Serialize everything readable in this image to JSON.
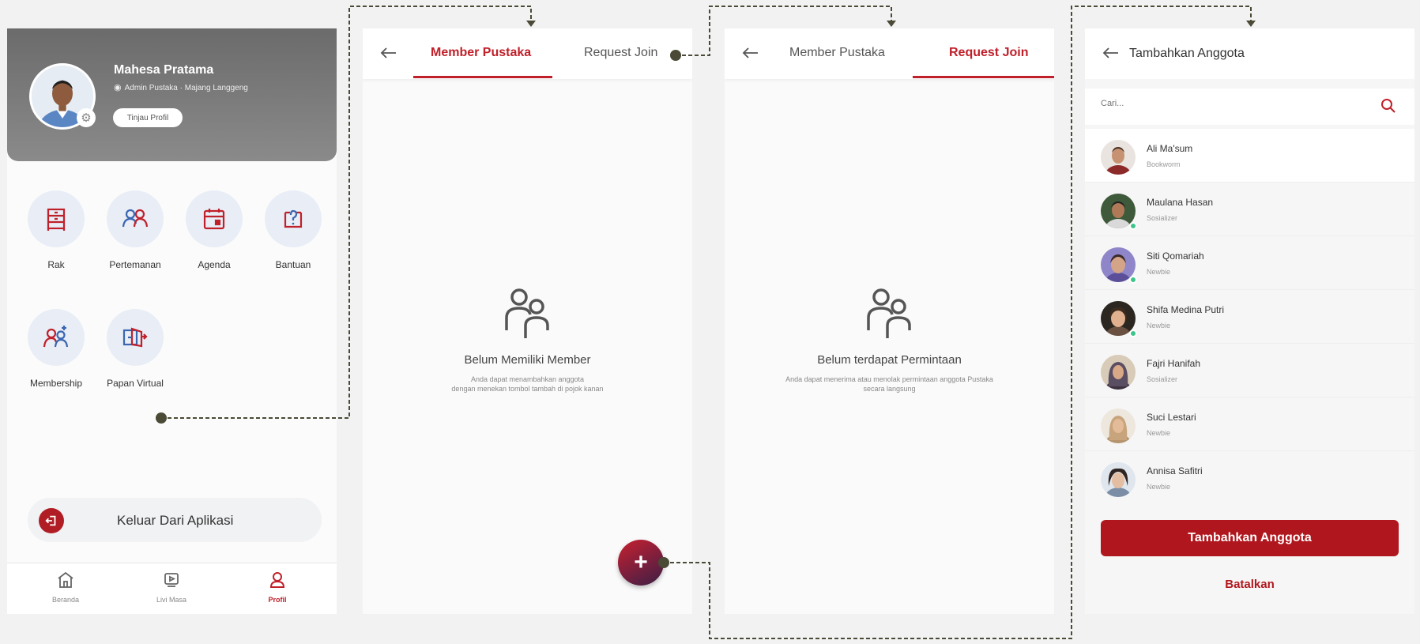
{
  "colors": {
    "accent": "#c0202a",
    "brand_dark": "#b0161d",
    "menu_icon": "#c0202a",
    "connector": "#4a4a36",
    "online": "#3cc58a"
  },
  "profile": {
    "name": "Mahesa Pratama",
    "role": "Admin Pustaka · Majang Langgeng",
    "view_profile_label": "Tinjau Profil",
    "menu": [
      {
        "label": "Rak",
        "icon": "shelf-icon"
      },
      {
        "label": "Pertemanan",
        "icon": "friends-icon"
      },
      {
        "label": "Agenda",
        "icon": "calendar-icon"
      },
      {
        "label": "Bantuan",
        "icon": "help-icon"
      },
      {
        "label": "Membership",
        "icon": "membership-icon"
      },
      {
        "label": "Papan Virtual",
        "icon": "virtual-board-icon"
      }
    ],
    "logout_label": "Keluar Dari Aplikasi",
    "nav": [
      {
        "label": "Beranda",
        "icon": "home-icon"
      },
      {
        "label": "Livi Masa",
        "icon": "video-icon"
      },
      {
        "label": "Profil",
        "icon": "profile-icon",
        "active": true
      }
    ]
  },
  "members": {
    "tabs": [
      "Member Pustaka",
      "Request Join"
    ],
    "active_tab": 0,
    "empty_title": "Belum Memiliki Member",
    "empty_desc_1": "Anda dapat menambahkan anggota",
    "empty_desc_2": "dengan menekan tombol tambah di pojok kanan",
    "fab_label": "+"
  },
  "requests": {
    "tabs": [
      "Member Pustaka",
      "Request Join"
    ],
    "active_tab": 1,
    "empty_title": "Belum terdapat Permintaan",
    "empty_desc_1": "Anda dapat menerima atau menolak permintaan anggota Pustaka",
    "empty_desc_2": "secara langsung"
  },
  "add_member": {
    "title": "Tambahkan Anggota",
    "search_placeholder": "Cari...",
    "users": [
      {
        "name": "Ali Ma'sum",
        "tag": "Bookworm",
        "online": false
      },
      {
        "name": "Maulana Hasan",
        "tag": "Sosializer",
        "online": true
      },
      {
        "name": "Siti Qomariah",
        "tag": "Newbie",
        "online": true
      },
      {
        "name": "Shifa Medina Putri",
        "tag": "Newbie",
        "online": true
      },
      {
        "name": "Fajri Hanifah",
        "tag": "Sosializer",
        "online": false
      },
      {
        "name": "Suci Lestari",
        "tag": "Newbie",
        "online": false
      },
      {
        "name": "Annisa Safitri",
        "tag": "Newbie",
        "online": false
      }
    ],
    "submit_label": "Tambahkan Anggota",
    "cancel_label": "Batalkan"
  }
}
